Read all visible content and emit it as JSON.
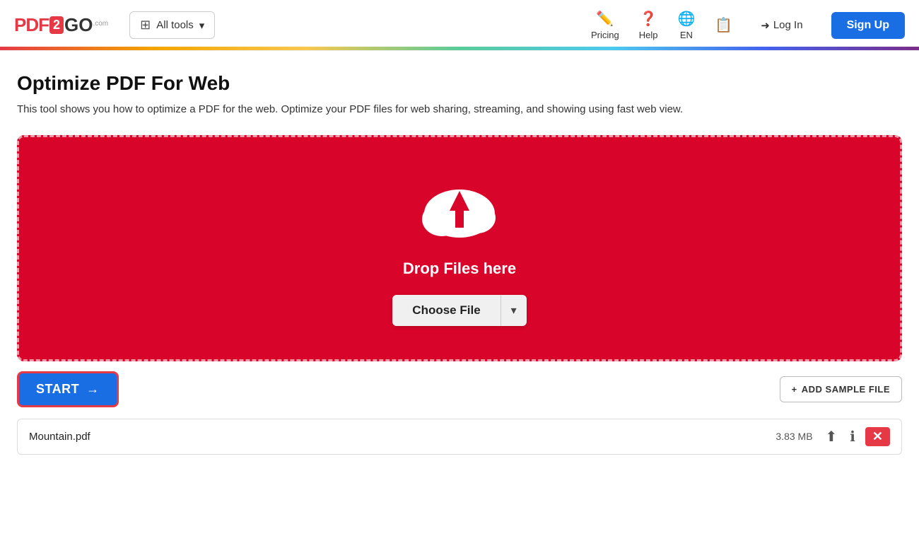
{
  "logo": {
    "part1": "PDF",
    "part2": "2",
    "part3": "GO",
    "com": ".com"
  },
  "header": {
    "all_tools_label": "All tools",
    "pricing_label": "Pricing",
    "help_label": "Help",
    "language_label": "EN",
    "login_label": "Log In",
    "signup_label": "Sign Up"
  },
  "page": {
    "title": "Optimize PDF For Web",
    "description": "This tool shows you how to optimize a PDF for the web. Optimize your PDF files for web sharing, streaming, and showing using fast web view."
  },
  "dropzone": {
    "drop_text": "Drop Files here",
    "choose_file_label": "Choose File",
    "choose_file_arrow": "▾"
  },
  "toolbar": {
    "start_label": "START",
    "start_arrow": "→",
    "add_sample_plus": "+",
    "add_sample_label": "ADD SAMPLE FILE"
  },
  "file": {
    "name": "Mountain.pdf",
    "size": "3.83 MB"
  }
}
